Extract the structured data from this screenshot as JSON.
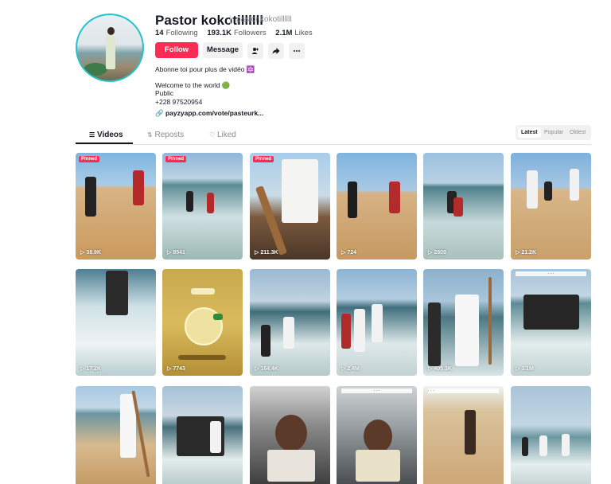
{
  "profile": {
    "name": "Pastor kokotillllll",
    "handle": "pastor.kokotillllll",
    "following_count": "14",
    "following_label": "Following",
    "followers_count": "193.1K",
    "followers_label": "Followers",
    "likes_count": "2.1M",
    "likes_label": "Likes",
    "follow_label": "Follow",
    "message_label": "Message",
    "bio_line1": "Abonne toi pour plus de vidéo 🔯",
    "bio_line2": "Welcome to the world 🟢",
    "bio_line3": "Public",
    "bio_line4": "+228 97520954",
    "link": "payzyapp.com/vote/pasteurk..."
  },
  "tabs": {
    "videos": "Videos",
    "reposts": "Reposts",
    "liked": "Liked"
  },
  "sort": {
    "latest": "Latest",
    "popular": "Popular",
    "oldest": "Oldest"
  },
  "videos": [
    {
      "views": "38.9K",
      "badge": "Pinned"
    },
    {
      "views": "8541",
      "badge": "Pinned"
    },
    {
      "views": "211.3K",
      "badge": "Pinned"
    },
    {
      "views": "724"
    },
    {
      "views": "2809"
    },
    {
      "views": "21.2K"
    },
    {
      "views": "17.2K"
    },
    {
      "views": "7743"
    },
    {
      "views": "164.4K"
    },
    {
      "views": "2.4M"
    },
    {
      "views": "405.3K"
    },
    {
      "views": "3.1M"
    },
    {
      "views": ""
    },
    {
      "views": ""
    },
    {
      "views": ""
    },
    {
      "views": ""
    },
    {
      "views": ""
    },
    {
      "views": ""
    }
  ],
  "colors": {
    "accent": "#fe2c55",
    "avatar_ring": "#25c2c9"
  }
}
